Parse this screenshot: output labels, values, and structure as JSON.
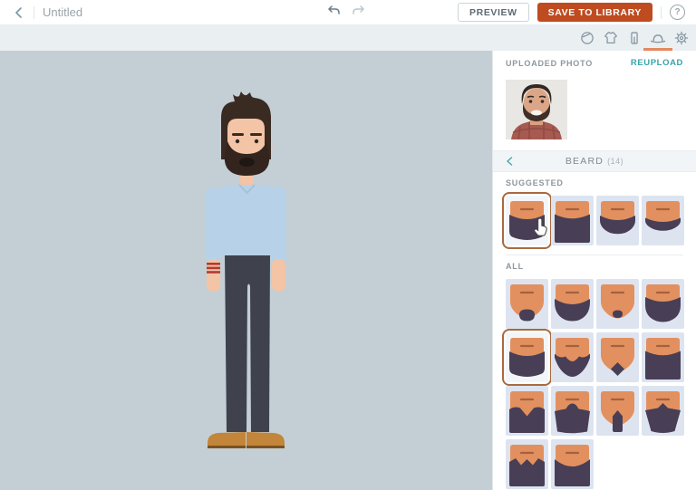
{
  "topbar": {
    "title": "Untitled",
    "preview_label": "PREVIEW",
    "save_label": "SAVE TO LIBRARY",
    "help_label": "?"
  },
  "toolbar": {
    "tabs": [
      {
        "icon": "head-icon",
        "active": false
      },
      {
        "icon": "shirt-icon",
        "active": false
      },
      {
        "icon": "pants-icon",
        "active": false
      },
      {
        "icon": "hat-icon",
        "active": true
      },
      {
        "icon": "gear-icon",
        "active": false
      }
    ]
  },
  "panel": {
    "uploaded_photo_label": "UPLOADED PHOTO",
    "reupload_label": "REUPLOAD",
    "category": {
      "title": "BEARD",
      "count": "(14)"
    },
    "suggested_label": "SUGGESTED",
    "all_label": "ALL",
    "suggested": [
      {
        "shape": "full-round",
        "selected": true
      },
      {
        "shape": "full-square",
        "selected": false
      },
      {
        "shape": "band-medium",
        "selected": false
      },
      {
        "shape": "band-thin",
        "selected": false
      }
    ],
    "all": [
      {
        "shape": "goatee-round",
        "selected": false
      },
      {
        "shape": "crescent-wide",
        "selected": false
      },
      {
        "shape": "patch-small",
        "selected": false
      },
      {
        "shape": "band-full",
        "selected": false
      },
      {
        "shape": "full-round",
        "selected": true
      },
      {
        "shape": "v-point",
        "selected": false
      },
      {
        "shape": "diamond",
        "selected": false
      },
      {
        "shape": "full-square",
        "selected": false
      },
      {
        "shape": "full-m-notch",
        "selected": false
      },
      {
        "shape": "full-dome",
        "selected": false
      },
      {
        "shape": "strip-vertical",
        "selected": false
      },
      {
        "shape": "taper-peak",
        "selected": false
      },
      {
        "shape": "full-zigzag",
        "selected": false
      },
      {
        "shape": "full-curve",
        "selected": false
      }
    ]
  },
  "colors": {
    "accent_orange": "#bf4b20",
    "tab_underline": "#e5885f",
    "teal_link": "#38a3a7",
    "selection_border": "#a96a3e",
    "canvas_bg": "#c4cfd5",
    "thumb_bg": "#dde4f0",
    "thumb_skin": "#e2905f",
    "thumb_mouth": "#a5613e",
    "thumb_beard": "#483e55"
  }
}
